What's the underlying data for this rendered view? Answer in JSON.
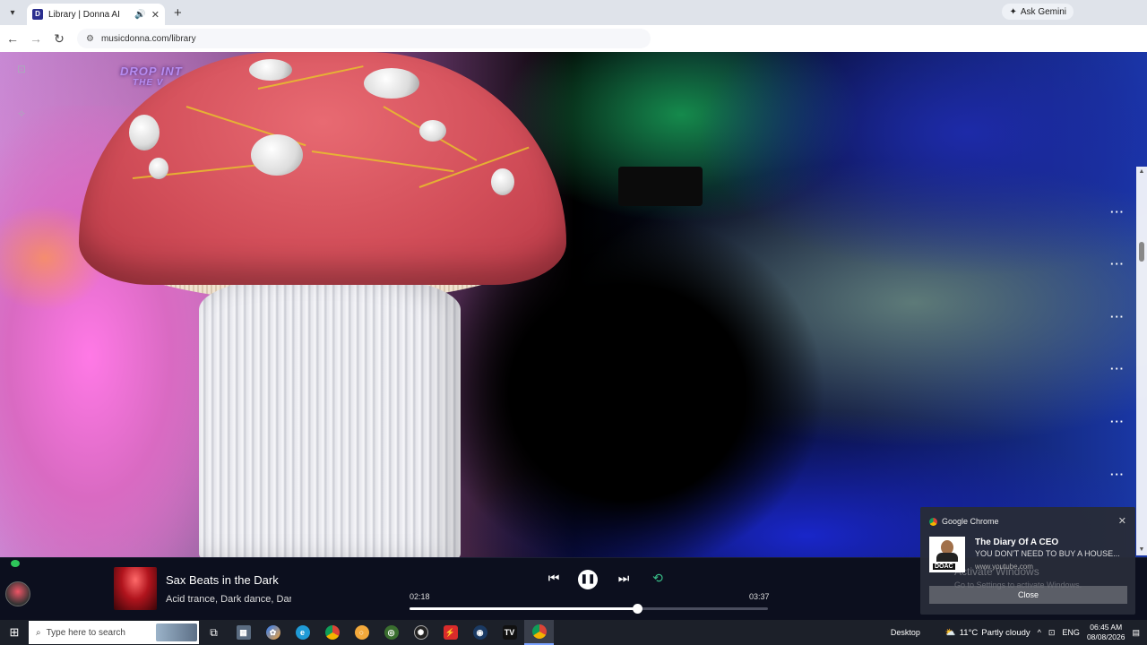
{
  "browser": {
    "tab_title": "Library | Donna AI",
    "favicon_letter": "D",
    "url": "musicdonna.com/library",
    "ask_gemini": "Ask Gemini"
  },
  "visualizer": {
    "logo_line1": "DROP INT",
    "logo_line2": "THE V"
  },
  "player": {
    "track_title": "Sax Beats in the Dark",
    "track_tags": "Acid trance, Dark dance, Dar",
    "current_time": "02:18",
    "duration": "03:37",
    "progress": 0.635
  },
  "notification": {
    "app": "Google Chrome",
    "title": "The Diary Of A CEO",
    "body": "YOU DON'T NEED TO BUY A HOUSE...",
    "source": "www.youtube.com",
    "thumb_label": "DOAC",
    "button": "Close",
    "activate_title": "Activate Windows",
    "activate_sub": "Go to Settings to activate Windows."
  },
  "taskbar": {
    "search_placeholder": "Type here to search",
    "desktop_label": "Desktop",
    "temperature": "11°C",
    "weather": "Partly cloudy",
    "language": "ENG",
    "time": "06:45 AM",
    "date": "08/08/2026"
  },
  "colors": {
    "player_bg": "#0c0f1e",
    "repeat_active": "#39c08a",
    "taskbar_bg": "#1c2029"
  }
}
